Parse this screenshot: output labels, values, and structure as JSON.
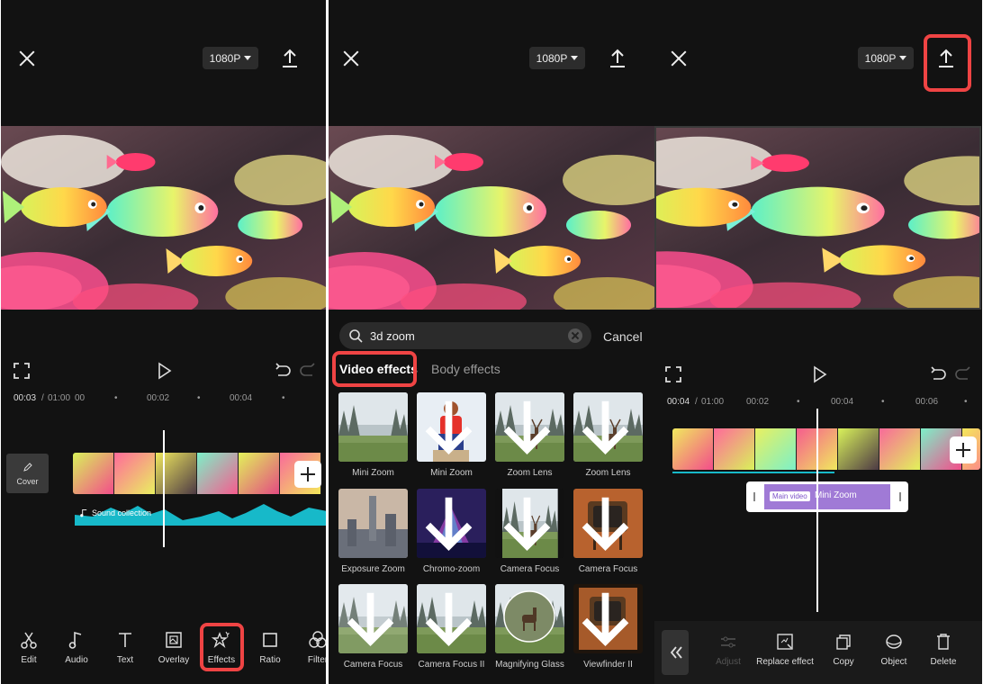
{
  "colors": {
    "background": "#121212",
    "highlight": "#ef4444",
    "audio_wave": "#17b9c9",
    "effect_clip": "#a07ad6"
  },
  "panel1": {
    "resolution": "1080P",
    "time_current": "00:03",
    "time_total": "01:00",
    "ruler_ticks": [
      "00",
      "00:02",
      "00:04"
    ],
    "cover_label": "Cover",
    "audio_label": "Sound collection",
    "toolbar": [
      {
        "label": "Edit",
        "icon": "scissors-icon"
      },
      {
        "label": "Audio",
        "icon": "music-note-icon"
      },
      {
        "label": "Text",
        "icon": "text-icon"
      },
      {
        "label": "Overlay",
        "icon": "overlay-icon"
      },
      {
        "label": "Effects",
        "icon": "effects-star-icon"
      },
      {
        "label": "Ratio",
        "icon": "ratio-square-icon"
      },
      {
        "label": "Filter",
        "icon": "filter-circles-icon"
      }
    ]
  },
  "panel2": {
    "resolution": "1080P",
    "search_value": "3d zoom",
    "cancel_label": "Cancel",
    "tabs": [
      "Video effects",
      "Body effects"
    ],
    "effects": [
      {
        "name": "Mini Zoom"
      },
      {
        "name": "Mini Zoom"
      },
      {
        "name": "Zoom Lens"
      },
      {
        "name": "Zoom Lens"
      },
      {
        "name": "Exposure Zoom"
      },
      {
        "name": "Chromo-zoom"
      },
      {
        "name": "Camera Focus"
      },
      {
        "name": "Camera Focus"
      },
      {
        "name": "Camera Focus"
      },
      {
        "name": "Camera Focus II"
      },
      {
        "name": "Magnifying Glass"
      },
      {
        "name": "Viewfinder II"
      }
    ]
  },
  "panel3": {
    "resolution": "1080P",
    "time_current": "00:04",
    "time_total": "01:00",
    "ruler_ticks": [
      "00:02",
      "00:04",
      "00:06"
    ],
    "effect_clip": {
      "tag": "Main video",
      "name": "Mini Zoom"
    },
    "toolbar": [
      {
        "label": "Adjust",
        "icon": "sliders-icon"
      },
      {
        "label": "Replace effect",
        "icon": "replace-effect-icon"
      },
      {
        "label": "Copy",
        "icon": "copy-icon"
      },
      {
        "label": "Object",
        "icon": "object-icon"
      },
      {
        "label": "Delete",
        "icon": "trash-icon"
      }
    ]
  }
}
